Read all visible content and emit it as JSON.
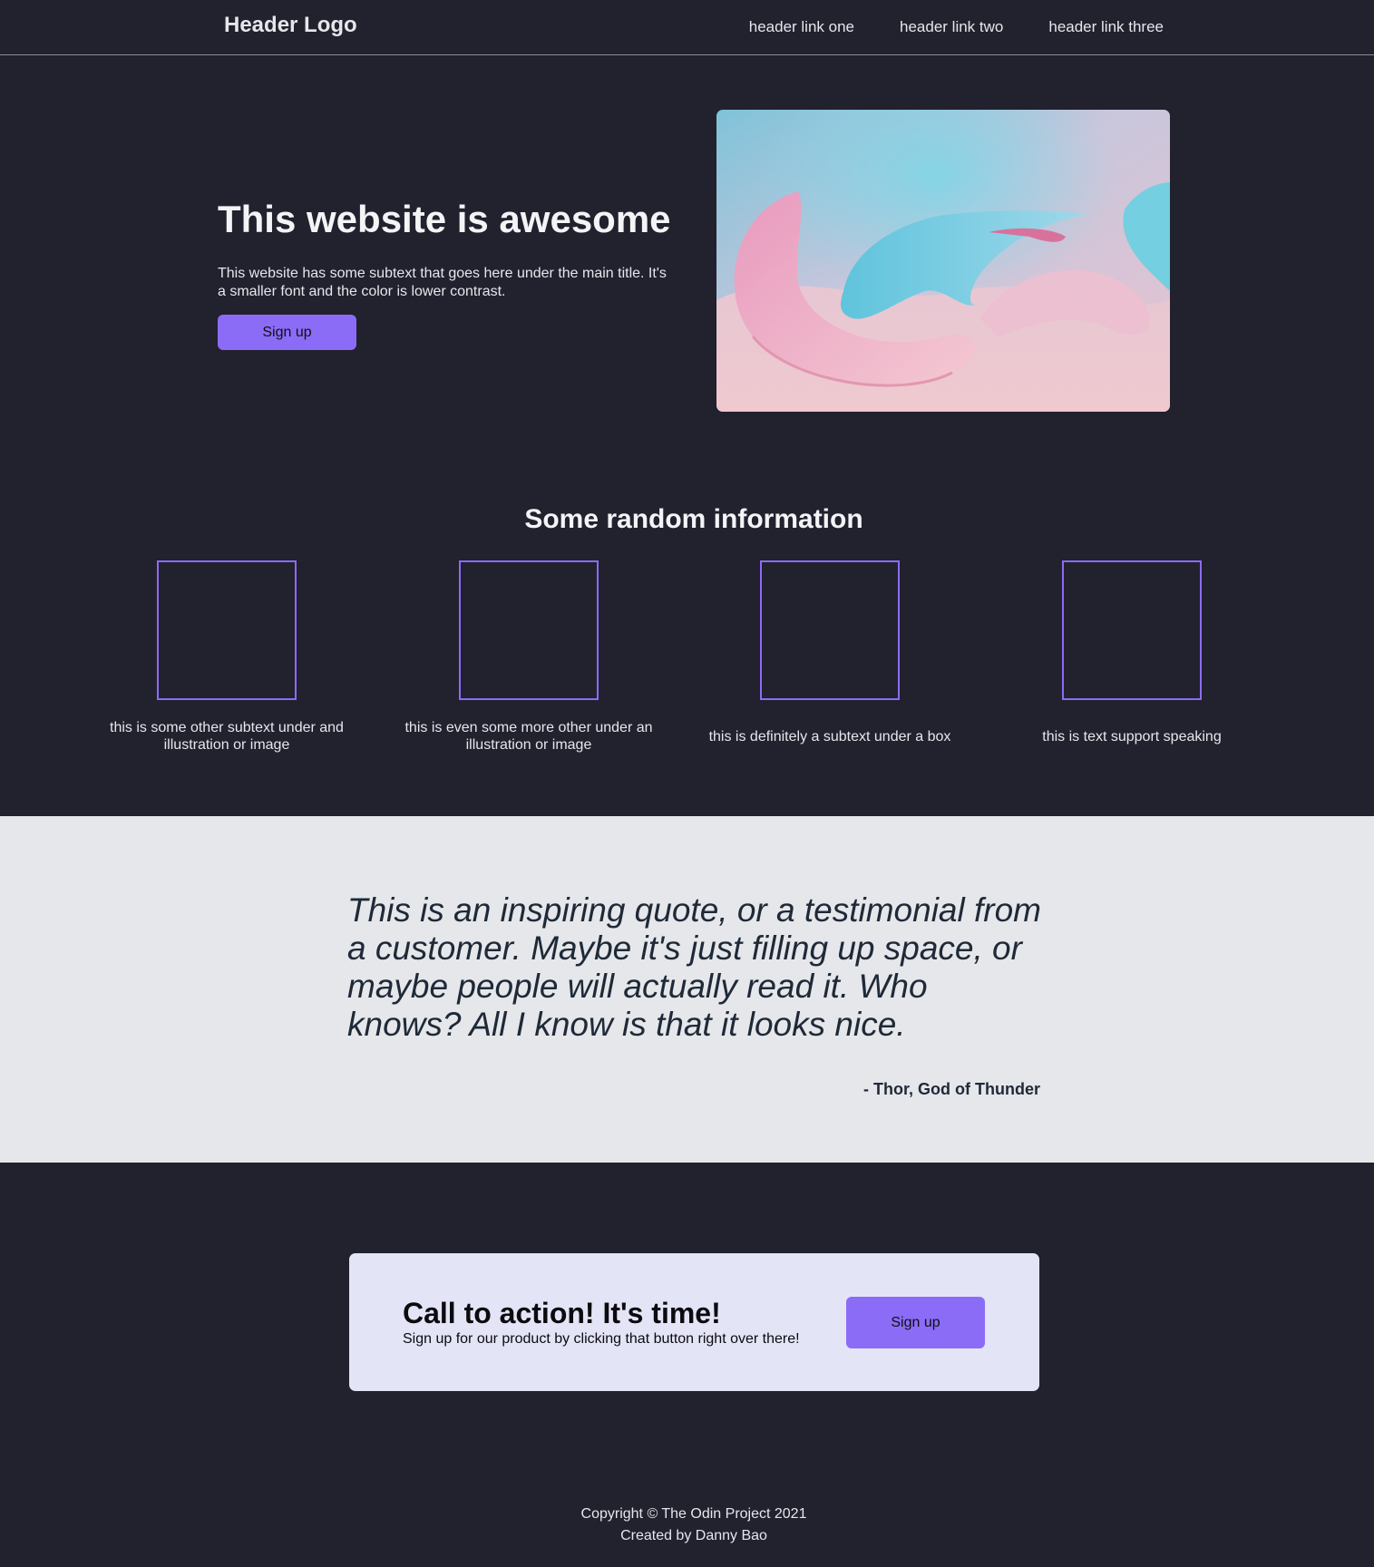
{
  "header": {
    "logo": "Header Logo",
    "links": [
      "header link one",
      "header link two",
      "header link three"
    ]
  },
  "hero": {
    "title": "This website is awesome",
    "subtext": "This website has some subtext that goes here under the main title. It's a smaller font and the color is lower contrast.",
    "button_label": "Sign up"
  },
  "info": {
    "title": "Some random information",
    "items": [
      {
        "caption": "this is some other subtext under and illustration or image"
      },
      {
        "caption": "this is even some more other under an illustration or image"
      },
      {
        "caption": "this is definitely a subtext under a box"
      },
      {
        "caption": "this is text support speaking"
      }
    ]
  },
  "quote": {
    "text": "This is an inspiring quote, or a testimonial from a customer. Maybe it's just filling up space, or maybe people will actually read it. Who knows? All I know is that it looks nice.",
    "author": "- Thor, God of Thunder"
  },
  "cta": {
    "title": "Call to action! It's time!",
    "subtext": "Sign up for our product by clicking that button right over there!",
    "button_label": "Sign up"
  },
  "footer": {
    "copyright": "Copyright © The Odin Project 2021",
    "credit": "Created by Danny Bao"
  },
  "colors": {
    "background": "#22212e",
    "accent": "#8b6cf6",
    "quote_background": "#e5e7eb",
    "cta_background": "#e4e4f7"
  }
}
